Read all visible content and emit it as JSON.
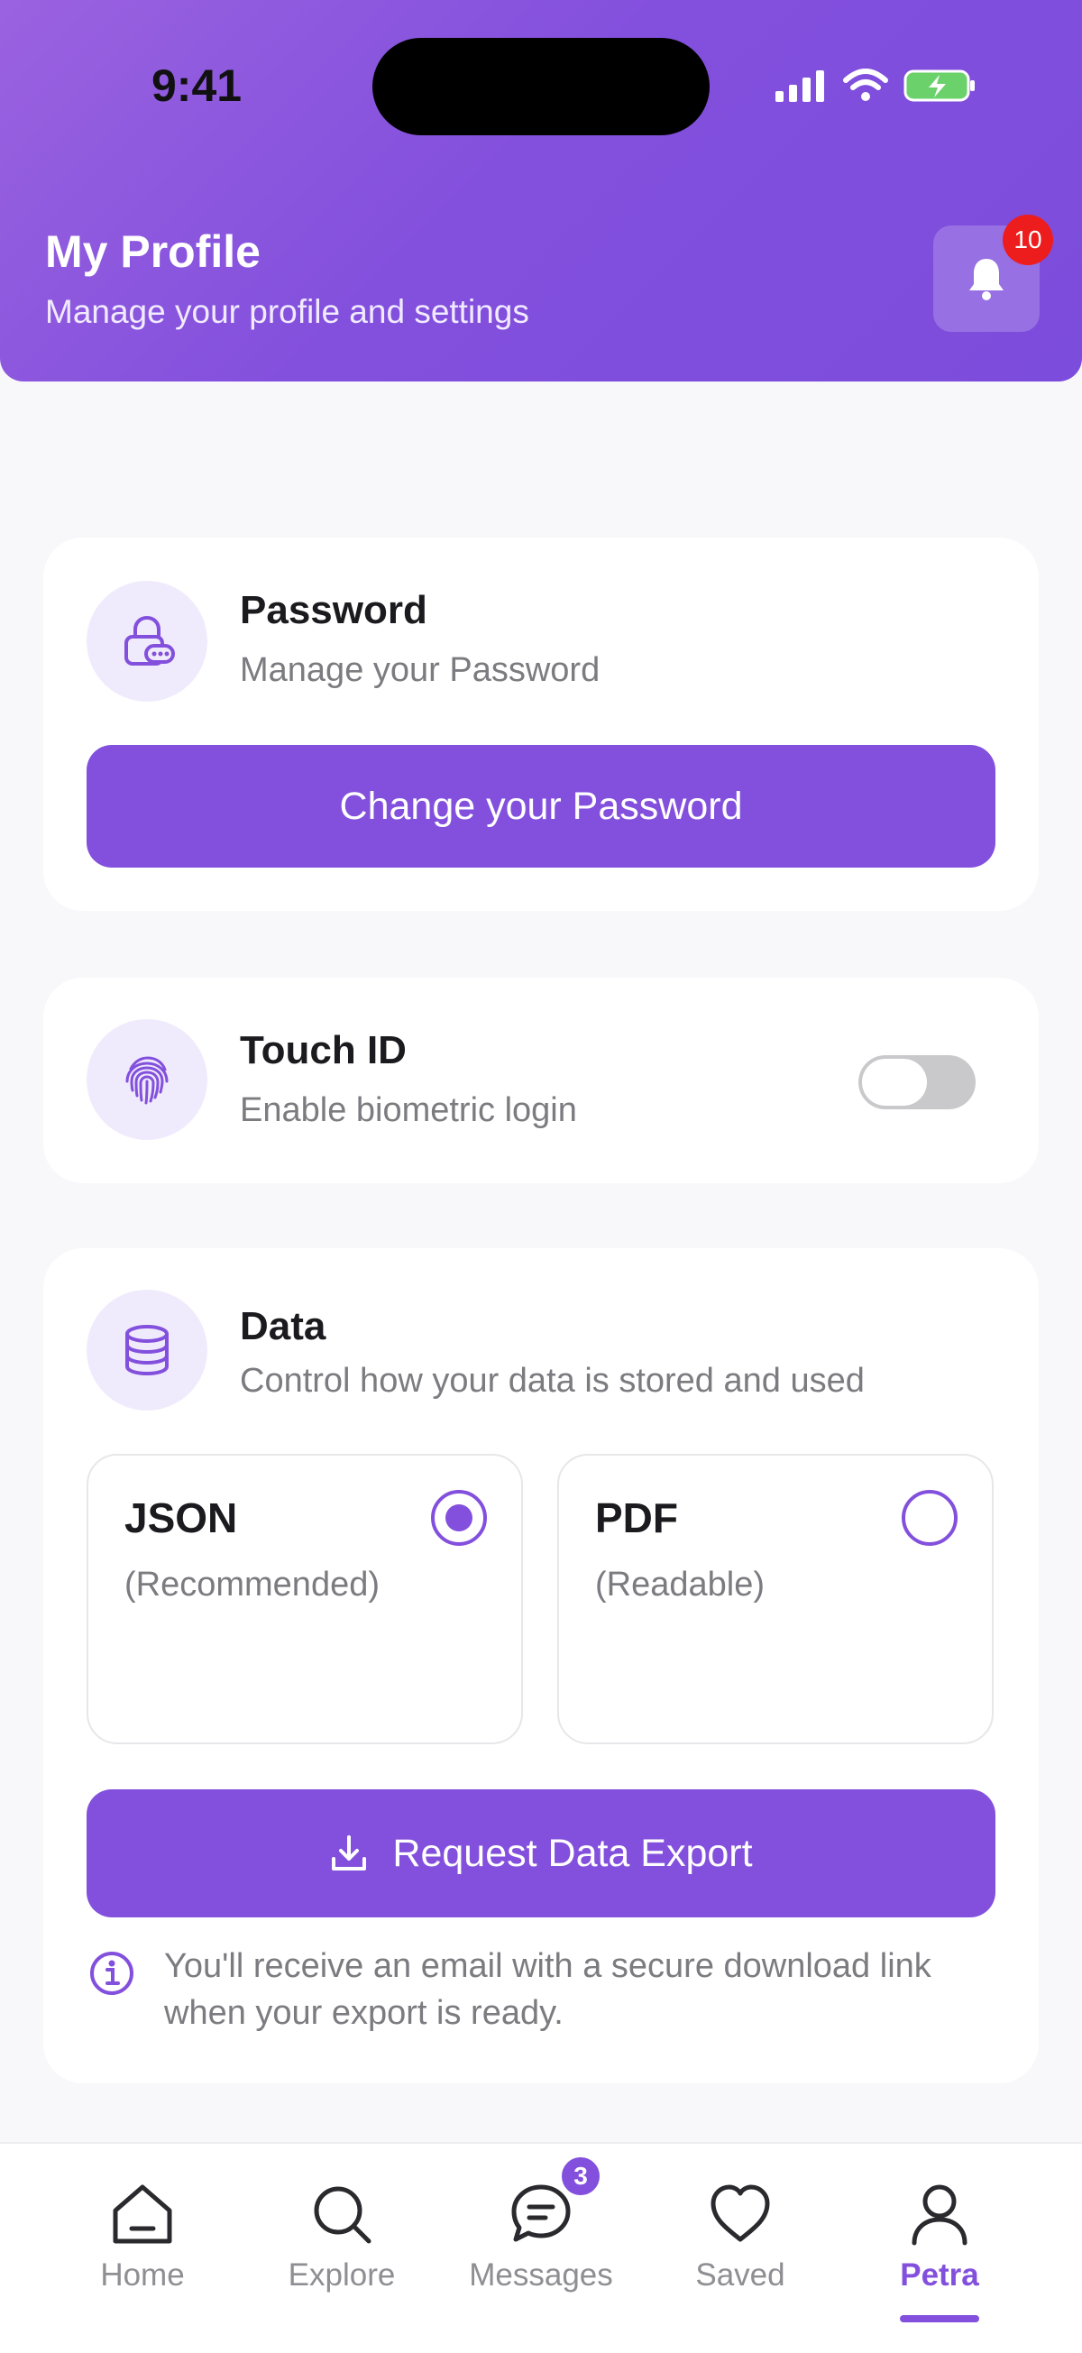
{
  "status_bar": {
    "time": "9:41"
  },
  "header": {
    "title": "My Profile",
    "subtitle": "Manage your profile and settings",
    "notification_count": "10"
  },
  "password_card": {
    "title": "Password",
    "subtitle": "Manage your Password",
    "button_label": "Change your Password",
    "icon": "lock-icon"
  },
  "touchid_card": {
    "title": "Touch ID",
    "subtitle": "Enable biometric login",
    "icon": "fingerprint-icon",
    "enabled": false
  },
  "data_card": {
    "title": "Data",
    "subtitle": "Control how your data is stored and used",
    "icon": "database-icon",
    "options": [
      {
        "title": "JSON",
        "subtitle": "(Recommended)",
        "selected": true
      },
      {
        "title": "PDF",
        "subtitle": "(Readable)",
        "selected": false
      }
    ],
    "export_button_label": "Request Data Export",
    "note": "You'll receive an email with a secure download link when your export is ready."
  },
  "tabbar": {
    "items": [
      {
        "label": "Home",
        "icon": "home-icon"
      },
      {
        "label": "Explore",
        "icon": "search-icon"
      },
      {
        "label": "Messages",
        "icon": "chat-icon",
        "badge": "3"
      },
      {
        "label": "Saved",
        "icon": "heart-icon"
      },
      {
        "label": "Petra",
        "icon": "user-icon",
        "active": true
      }
    ]
  },
  "colors": {
    "accent": "#8350dd",
    "badge_red": "#ee1d1d",
    "icon_bg": "#f0ebfc"
  }
}
